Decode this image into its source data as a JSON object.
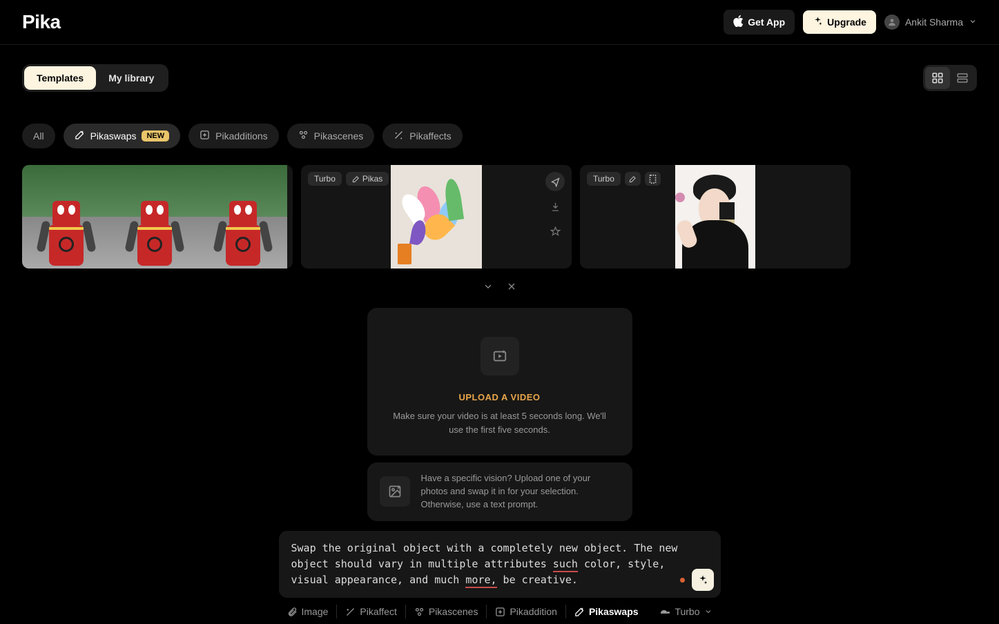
{
  "header": {
    "logo": "Pika",
    "get_app": "Get App",
    "upgrade": "Upgrade",
    "user_name": "Ankit Sharma"
  },
  "tabs": {
    "templates": "Templates",
    "my_library": "My library"
  },
  "filters": {
    "all": "All",
    "pikaswaps": "Pikaswaps",
    "pikaswaps_badge": "NEW",
    "pikadditions": "Pikadditions",
    "pikascenes": "Pikascenes",
    "pikaffects": "Pikaffects"
  },
  "cards": [
    {
      "mode": "",
      "type": ""
    },
    {
      "mode": "Turbo",
      "type": "Pikas"
    },
    {
      "mode": "Turbo",
      "type": ""
    }
  ],
  "upload": {
    "title": "UPLOAD A VIDEO",
    "desc": "Make sure your video is at least 5 seconds long. We'll use the first five seconds."
  },
  "hint": {
    "text": "Have a specific vision? Upload one of your photos and swap it in for your selection. Otherwise, use a text prompt."
  },
  "prompt": {
    "seg1": "Swap the original object with a completely new object. The new object should vary in multiple attributes ",
    "u1": "such",
    "seg2": " color, style, visual appearance, and much ",
    "u2": "more,",
    "seg3": " be creative."
  },
  "bottom": {
    "image": "Image",
    "pikaffect": "Pikaffect",
    "pikascenes": "Pikascenes",
    "pikaddition": "Pikaddition",
    "pikaswaps": "Pikaswaps",
    "turbo": "Turbo"
  }
}
